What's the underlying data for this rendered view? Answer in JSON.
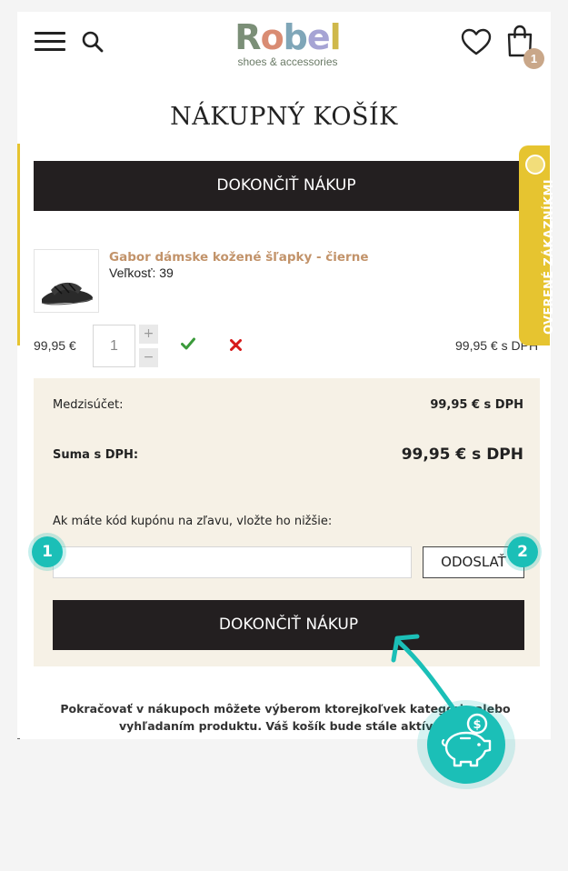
{
  "header": {
    "logo_word": [
      "R",
      "o",
      "b",
      "e",
      "l"
    ],
    "logo_tagline": "shoes & accessories",
    "cart_count": "1"
  },
  "page": {
    "title": "NÁKUPNÝ KOŠÍK",
    "checkout_top_label": "DOKONČIŤ NÁKUP"
  },
  "cart_item": {
    "name": "Gabor dámske kožené šľapky - čierne",
    "size": "Veľkosť: 39",
    "unit_price": "99,95 €",
    "quantity": "1",
    "qty_plus": "+",
    "qty_minus": "−",
    "line_total": "99,95 € s DPH"
  },
  "summary": {
    "subtotal_label": "Medzisúčet:",
    "subtotal_value": "99,95 € s DPH",
    "total_label": "Suma s DPH:",
    "total_value": "99,95 € s DPH",
    "coupon_label": "Ak máte kód kupónu na zľavu, vložte ho nižšie:",
    "coupon_value": "",
    "coupon_button": "ODOSLAŤ",
    "checkout_bottom_label": "DOKONČIŤ NÁKUP"
  },
  "footer": {
    "continue_text": "Pokračovať v nákupoch môžete výberom ktorejkoľvek kategórie alebo vyhľadaním produktu. Váš košík bude stále aktívny."
  },
  "verified_tab": {
    "label": "OVERENÉ ZÁKAZNÍKMI"
  },
  "tutorial": {
    "step_1": "1",
    "step_2": "2"
  },
  "colors": {
    "accent_teal": "#1bbfb7",
    "verified_yellow": "#e6c430",
    "product_link": "#c2936a",
    "summary_bg": "#f6f1e6",
    "dark_button": "#231f20"
  },
  "icons": [
    "hamburger-icon",
    "search-icon",
    "heart-icon",
    "cart-icon",
    "check-icon",
    "remove-icon",
    "piggy-bank-icon"
  ]
}
